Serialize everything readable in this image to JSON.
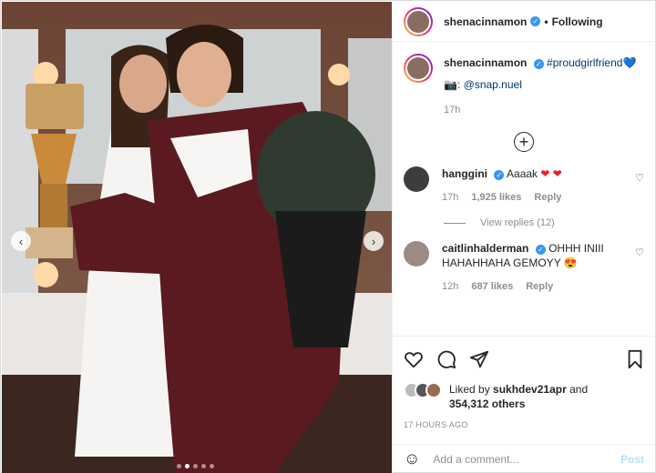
{
  "header": {
    "username": "shenacinnamon",
    "follow_label": "Following",
    "separator": "•"
  },
  "caption": {
    "username": "shenacinnamon",
    "hashtag": "#proudgirlfriend",
    "hashtag_emoji": "💙",
    "camera_emoji": "📷",
    "credit_label": ":",
    "mention": "@snap.nuel",
    "time": "17h"
  },
  "comments": [
    {
      "username": "hanggini",
      "text": "Aaaak",
      "emoji": "❤ ❤",
      "time": "17h",
      "likes": "1,925 likes",
      "reply": "Reply"
    },
    {
      "username": "caitlinhalderman",
      "text": "OHHH INIII HAHAHHAHA GEMOYY",
      "emoji": "😍",
      "time": "12h",
      "likes": "687 likes",
      "reply": "Reply"
    }
  ],
  "view_replies": "View replies (12)",
  "liked": {
    "prefix": "Liked by",
    "user": "sukhdev21apr",
    "and": "and",
    "others": "354,312 others"
  },
  "date": "17 HOURS AGO",
  "add_comment": {
    "placeholder": "Add a comment...",
    "post_label": "Post"
  },
  "carousel": {
    "slide_count": 5,
    "active_index": 1
  },
  "icons": {
    "verified": "verified-badge-icon",
    "heart": "heart-icon",
    "comment": "comment-icon",
    "share": "paper-plane-icon",
    "save": "bookmark-icon",
    "emoji": "smiley-icon",
    "more": "plus-circle-icon"
  },
  "colors": {
    "link": "#00376b",
    "verified": "#3897f0",
    "post_disabled": "#b2dffc",
    "meta": "#8e8e8e"
  }
}
